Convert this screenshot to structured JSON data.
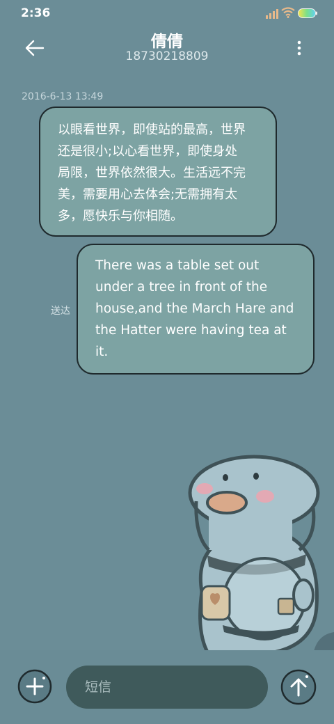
{
  "status_bar": {
    "time": "2:36"
  },
  "header": {
    "contact_name": "倩倩",
    "contact_number": "18730218809",
    "back_icon": "arrow-left-icon",
    "menu_icon": "more-vertical-icon"
  },
  "conversation": {
    "timestamp": "2016-6-13 13:49",
    "messages": [
      {
        "direction": "incoming",
        "lines": [
          "以眼看世界，即使站的最高，世界",
          "还是很小;以心看世界，即使身处",
          "局限，世界依然很大。生活远不完",
          "美，需要用心去体会;无需拥有太",
          "多，愿快乐与你相随。"
        ]
      },
      {
        "direction": "outgoing",
        "lines": [
          "There was a table set out",
          "under a tree in front of the",
          "house,and the March Hare and",
          "the Hatter were having tea at",
          "it."
        ],
        "status": "送达"
      }
    ]
  },
  "composer": {
    "placeholder": "短信",
    "attach_icon": "plus-icon",
    "send_icon": "arrow-up-icon"
  },
  "colors": {
    "background": "#6b8d97",
    "bubble": "#7da3a3",
    "bubble_border": "#1f2a2d",
    "input_bg": "#3f5a5b"
  }
}
